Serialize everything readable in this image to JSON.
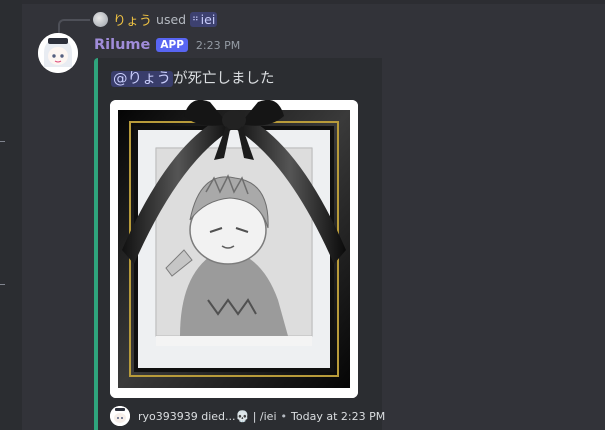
{
  "reply": {
    "username": "りょう",
    "used_text": "used",
    "command_icon": "slash-command-icon",
    "command_name": "iei"
  },
  "message": {
    "username": "Rilume",
    "badge": "APP",
    "timestamp": "2:23 PM"
  },
  "embed": {
    "accent_color": "#2fa47c",
    "mention": "@りょう",
    "description": "が死亡しました",
    "image_alt": "memorial-portrait",
    "footer": {
      "text": "ryo393939 died...💀 | /iei",
      "separator": "•",
      "time": "Today at 2:23 PM"
    }
  }
}
